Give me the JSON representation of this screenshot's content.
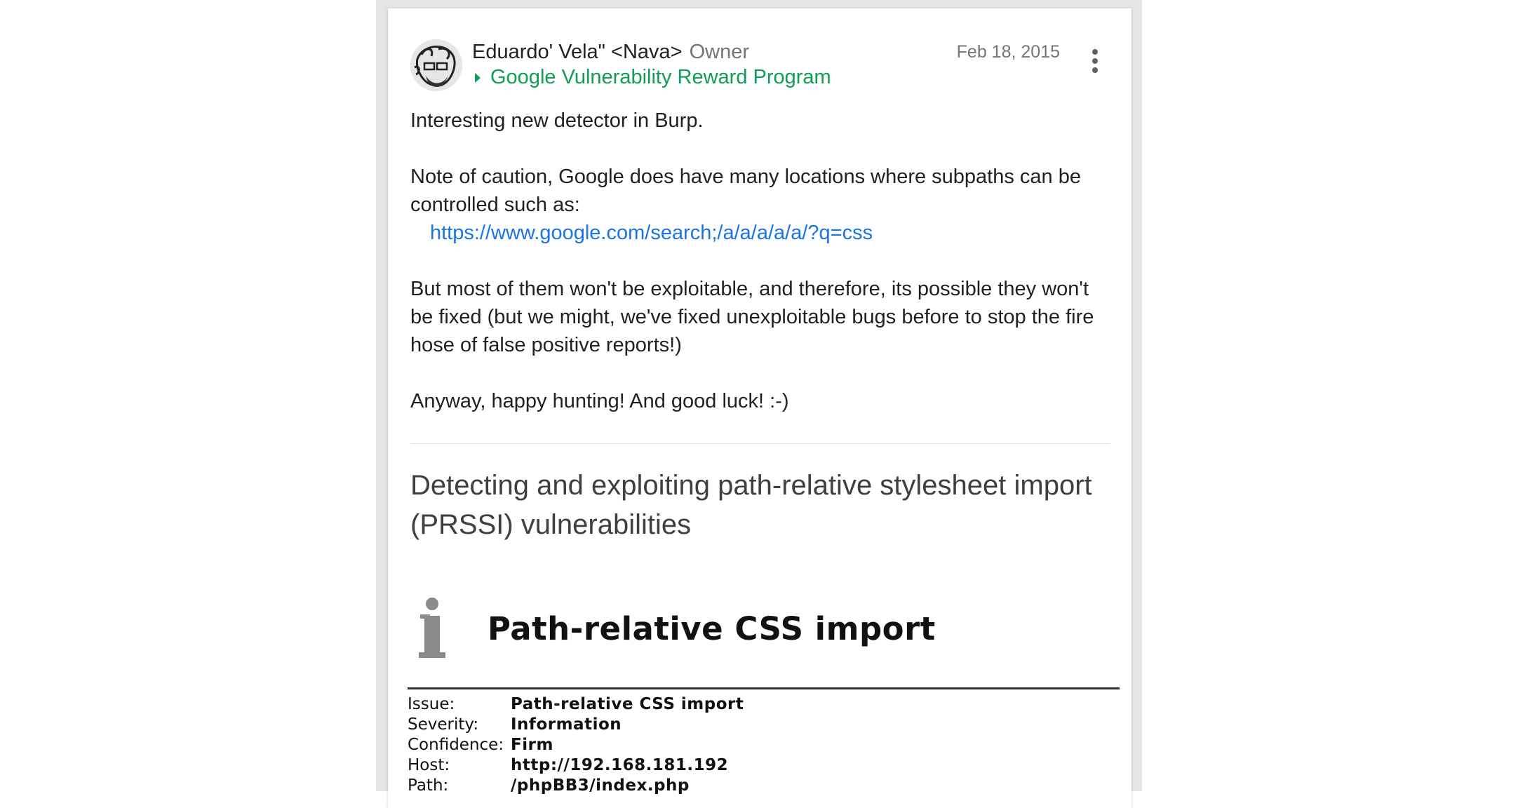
{
  "post": {
    "author": "Eduardo' Vela\" <Nava>",
    "role": "Owner",
    "group": "Google Vulnerability Reward Program",
    "date": "Feb 18, 2015",
    "body": {
      "p1": "Interesting new detector in Burp.",
      "p2": "Note of caution, Google does have many locations where subpaths can be controlled such as:",
      "link": "https://www.google.com/search;/a/a/a/a/a/?q=css",
      "p3": "But most of them won't be exploitable, and therefore, its possible they won't be fixed (but we might, we've fixed unexploitable bugs before to stop the fire hose of false positive reports!)",
      "p4": "Anyway, happy hunting! And good luck! :-)"
    }
  },
  "preview": {
    "title": "Detecting and exploiting path-relative stylesheet import (PRSSI) vulnerabilities"
  },
  "burp": {
    "title": "Path-relative CSS import",
    "rows": [
      {
        "label": "Issue:",
        "value": "Path-relative CSS import"
      },
      {
        "label": "Severity:",
        "value": "Information"
      },
      {
        "label": "Confidence:",
        "value": "Firm"
      },
      {
        "label": "Host:",
        "value": "http://192.168.181.192"
      },
      {
        "label": "Path:",
        "value": "/phpBB3/index.php"
      }
    ]
  },
  "colors": {
    "group_green": "#0f9d58",
    "link_blue": "#1a73e8",
    "meta_gray": "#757575"
  }
}
